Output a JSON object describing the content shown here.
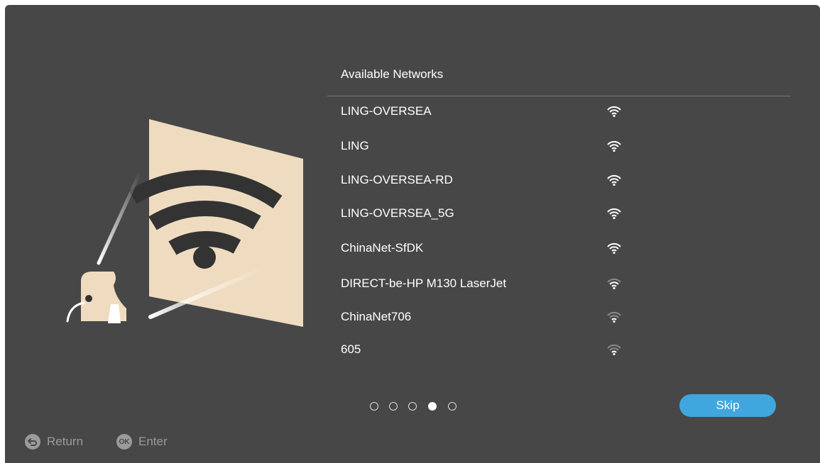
{
  "panel": {
    "title": "Available Networks"
  },
  "networks": [
    {
      "name": "LING-OVERSEA",
      "signal_bars": 3
    },
    {
      "name": "LING",
      "signal_bars": 3
    },
    {
      "name": "LING-OVERSEA-RD",
      "signal_bars": 3
    },
    {
      "name": "LING-OVERSEA_5G",
      "signal_bars": 3
    },
    {
      "name": "ChinaNet-SfDK",
      "signal_bars": 3
    },
    {
      "name": "DIRECT-be-HP M130 LaserJet",
      "signal_bars": 2
    },
    {
      "name": "ChinaNet706",
      "signal_bars": 1
    },
    {
      "name": "605",
      "signal_bars": 1
    }
  ],
  "pagination": {
    "total_pages": 5,
    "current_page": 4
  },
  "buttons": {
    "skip_label": "Skip"
  },
  "hints": {
    "return_label": "Return",
    "enter_label": "Enter",
    "enter_icon_text": "OK"
  },
  "icons": {
    "network_signal": "wifi-signal-icon",
    "return": "return-arrow-icon",
    "enter": "ok-button-icon",
    "illustration": "projector-wifi-illustration"
  },
  "colors": {
    "background": "#474747",
    "accent": "#3fa7dd",
    "illustration_panel": "#efdcc0",
    "hint": "#9b9b9b"
  }
}
